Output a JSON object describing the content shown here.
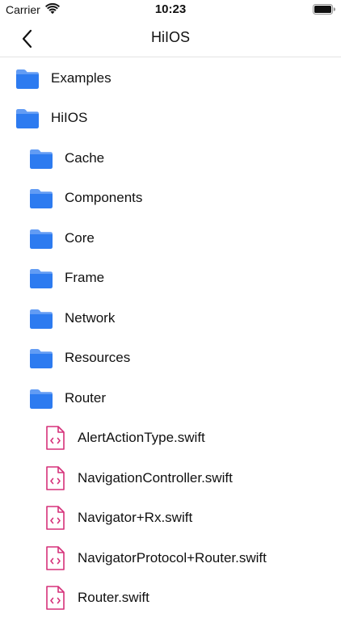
{
  "status_bar": {
    "carrier": "Carrier",
    "time": "10:23"
  },
  "nav": {
    "title": "HiIOS",
    "back_icon": "chevron-left-icon"
  },
  "colors": {
    "folder": "#2d7bf0",
    "file": "#d6317a",
    "divider": "#e4e4e4"
  },
  "tree": [
    {
      "type": "folder",
      "name": "Examples",
      "level": 0
    },
    {
      "type": "folder",
      "name": "HiIOS",
      "level": 0
    },
    {
      "type": "folder",
      "name": "Cache",
      "level": 1
    },
    {
      "type": "folder",
      "name": "Components",
      "level": 1
    },
    {
      "type": "folder",
      "name": "Core",
      "level": 1
    },
    {
      "type": "folder",
      "name": "Frame",
      "level": 1
    },
    {
      "type": "folder",
      "name": "Network",
      "level": 1
    },
    {
      "type": "folder",
      "name": "Resources",
      "level": 1
    },
    {
      "type": "folder",
      "name": "Router",
      "level": 1
    },
    {
      "type": "file",
      "name": "AlertActionType.swift",
      "level": 2
    },
    {
      "type": "file",
      "name": "NavigationController.swift",
      "level": 2
    },
    {
      "type": "file",
      "name": "Navigator+Rx.swift",
      "level": 2
    },
    {
      "type": "file",
      "name": "NavigatorProtocol+Router.swift",
      "level": 2
    },
    {
      "type": "file",
      "name": "Router.swift",
      "level": 2
    }
  ]
}
